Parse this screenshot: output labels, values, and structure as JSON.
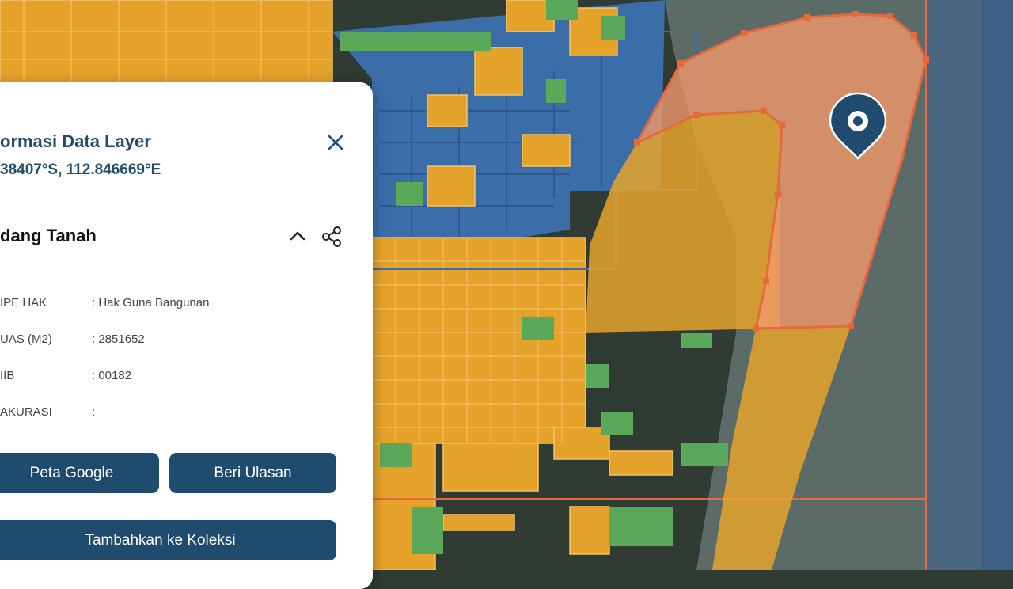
{
  "panel": {
    "title": "ormasi Data Layer",
    "coordinates": "38407°S, 112.846669°E",
    "close_icon": "close-icon",
    "section_title": "dang Tanah",
    "collapse_icon": "chevron-up-icon",
    "share_icon": "share-icon",
    "fields": [
      {
        "label": "IPE HAK",
        "value": ": Hak Guna Bangunan"
      },
      {
        "label": "UAS (M2)",
        "value": ": 2851652"
      },
      {
        "label": "IIB",
        "value": ": 00182"
      },
      {
        "label": "AKURASI",
        "value": ":"
      }
    ],
    "buttons": {
      "google_maps": "Peta Google",
      "review": "Beri Ulasan",
      "add_collection": "Tambahkan ke Koleksi"
    }
  },
  "map": {
    "marker_icon": "map-pin-icon",
    "colors": {
      "land_dark": "#2f3b33",
      "sea": "#4f6578",
      "parcel_orange": "#e5a32b",
      "parcel_green": "#5aa95a",
      "parcel_blue": "#3b6ea8",
      "highlight": "#f0996a",
      "highlight_stroke": "#e8673d",
      "marker": "#1f4b6e"
    }
  }
}
